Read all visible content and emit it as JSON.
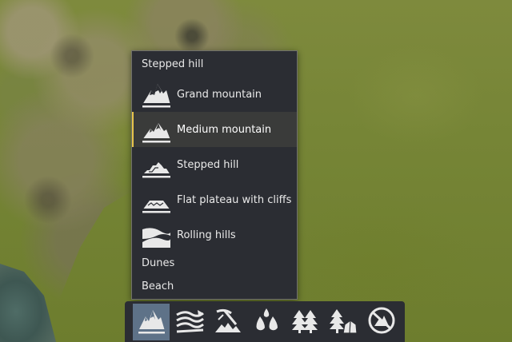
{
  "menu": {
    "header": "Stepped hill",
    "items": [
      {
        "label": "Grand mountain",
        "icon": "grand-mountain-icon",
        "selected": false
      },
      {
        "label": "Medium mountain",
        "icon": "medium-mountain-icon",
        "selected": true
      },
      {
        "label": "Stepped hill",
        "icon": "stepped-hill-icon",
        "selected": false
      },
      {
        "label": "Flat plateau with cliffs",
        "icon": "flat-plateau-icon",
        "selected": false
      },
      {
        "label": "Rolling hills",
        "icon": "rolling-hills-icon",
        "selected": false
      }
    ],
    "text_items": [
      "Dunes",
      "Beach"
    ],
    "accent_color": "#e6c34a"
  },
  "toolbar": {
    "tools": [
      {
        "icon": "terrain-mountain-icon",
        "active": true
      },
      {
        "icon": "terrain-smooth-icon",
        "active": false
      },
      {
        "icon": "excavate-icon",
        "active": false
      },
      {
        "icon": "water-drops-icon",
        "active": false
      },
      {
        "icon": "forest-icon",
        "active": false
      },
      {
        "icon": "trees-rocks-icon",
        "active": false
      },
      {
        "icon": "no-mountain-icon",
        "active": false
      }
    ],
    "active_color": "#5e7288"
  }
}
